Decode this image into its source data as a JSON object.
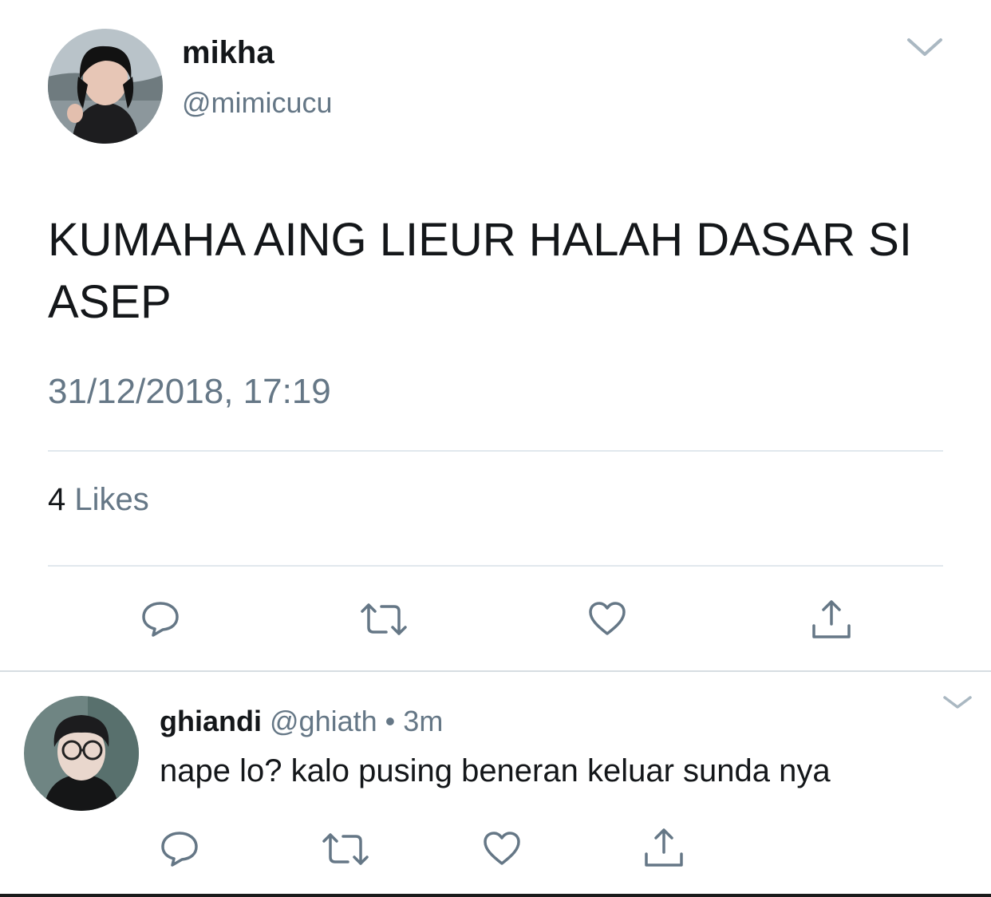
{
  "tweet": {
    "author_name": "mikha",
    "author_handle": "@mimicucu",
    "text": "KUMAHA AING LIEUR HALAH DASAR SI ASEP",
    "timestamp": "31/12/2018, 17:19",
    "likes_count": "4",
    "likes_label": "Likes",
    "actions": [
      "reply-icon",
      "retweet-icon",
      "like-icon",
      "share-icon"
    ],
    "menu_icon": "chevron-down-icon"
  },
  "reply": {
    "author_name": "ghiandi",
    "author_handle": "@ghiath",
    "separator": "•",
    "time_ago": "3m",
    "text": "nape lo? kalo pusing beneran keluar sunda nya",
    "actions": [
      "reply-icon",
      "retweet-icon",
      "like-icon",
      "share-icon"
    ],
    "menu_icon": "chevron-down-icon"
  },
  "colors": {
    "primary_text": "#14171a",
    "secondary_text": "#657786",
    "icon": "#657786",
    "divider": "#e1e8ed"
  }
}
